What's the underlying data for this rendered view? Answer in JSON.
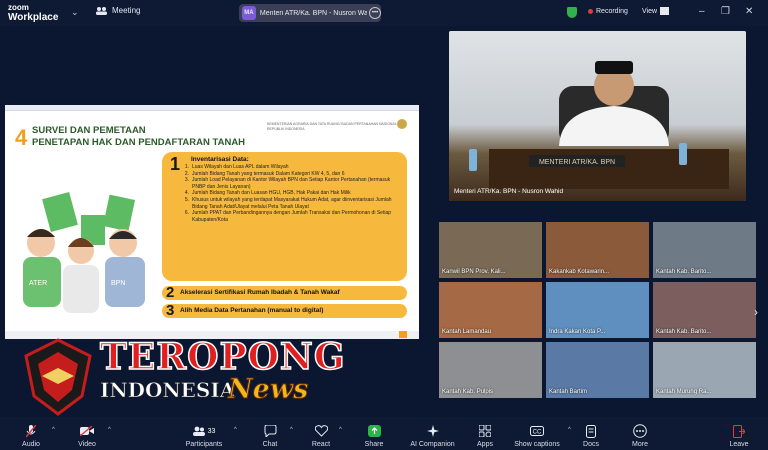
{
  "app": {
    "logo_top": "zoom",
    "logo_bottom": "Workplace",
    "meeting_label": "Meeting"
  },
  "speaker_chip": {
    "initials": "MA",
    "name": "Menteri ATR/Ka. BPN - Nusron Wahid"
  },
  "status": {
    "recording": "Recording",
    "view": "View"
  },
  "slide": {
    "number": "4",
    "title_line1": "SURVEI DAN PEMETAAN",
    "title_line2": "PENETAPAN HAK DAN PENDAFTARAN TANAH",
    "ministry": "KEMENTERIAN AGRARIA DAN TATA RUANG/ BADAN PERTANAHAN NASIONAL REPUBLIK INDONESIA",
    "box1_number": "1",
    "box1_title": "Inventarisasi Data:",
    "box1_items": [
      {
        "n": "1.",
        "text": "Luas Wilayah dan Luas APL dalam Wilayah"
      },
      {
        "n": "2.",
        "text": "Jumlah Bidang Tanah yang termasuk Dalam Kategori KW 4, 5, dan 6"
      },
      {
        "n": "3.",
        "text": "Jumlah Load Pelayanan di Kantor Wilayah BPN dan Setiap Kantor Pertanahan (termasuk PNBP dan Jenis Layanan)"
      },
      {
        "n": "4.",
        "text": "Jumlah Bidang Tanah dan Luasan HGU, HGB, Hak Pakai dan Hak Milik"
      },
      {
        "n": "5.",
        "text": "Khusus untuk wilayah yang terdapat Masyarakat Hukum Adat, agar diinventarisasi Jumlah Bidang Tanah Adat/Ulayat melalui Peta Tanah Ulayat"
      },
      {
        "n": "6.",
        "text": "Jumlah PPAT dan Perbandingannya dengan Jumlah Transaksi dan Permohonan di Setiap Kabupaten/Kota"
      }
    ],
    "box2_number": "2",
    "box2_text": "Akselerasi Sertifikasi Rumah Ibadah & Tanah Wakaf",
    "box3_number": "3",
    "box3_text": "Alih Media Data Pertanahan (manual to digital)"
  },
  "main_video": {
    "label": "Menteri ATR/Ka. BPN - Nusron Wahid",
    "desk_sign": "MENTERI ATR/KA. BPN"
  },
  "tiles": [
    {
      "label": "Kanwil BPN Prov. Kali..."
    },
    {
      "label": "Kakankab Kotawarin..."
    },
    {
      "label": "Kantah Kab. Barito..."
    },
    {
      "label": "Kantah Lamandau"
    },
    {
      "label": "Indra Kakan Kota P..."
    },
    {
      "label": "Kantah Kab. Barito..."
    },
    {
      "label": "Kantah Kab. Pulpis"
    },
    {
      "label": "Kantah Bartim"
    },
    {
      "label": "Kantah Murung Ra..."
    }
  ],
  "watermark": {
    "line1": "TEROPONG",
    "line2": "INDONESIA",
    "line3": "News",
    "emblem_text": "TEROPONG INDONESIA NEWS"
  },
  "toolbar": {
    "audio": "Audio",
    "video": "Video",
    "participants": "Participants",
    "participants_count": "33",
    "chat": "Chat",
    "react": "React",
    "share": "Share",
    "ai": "AI Companion",
    "apps": "Apps",
    "captions": "Show captions",
    "docs": "Docs",
    "more": "More",
    "leave": "Leave"
  },
  "colors": {
    "accent_orange": "#f6b93d",
    "share_green": "#2fb34a",
    "leave_red": "#e23b3b"
  }
}
